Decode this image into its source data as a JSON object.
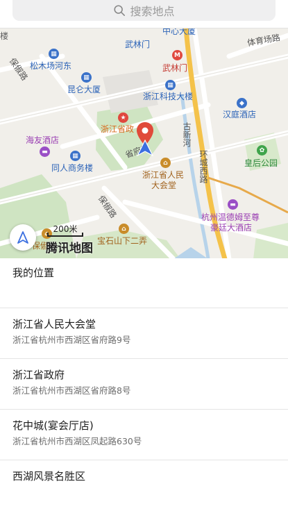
{
  "search": {
    "placeholder": "搜索地点"
  },
  "map": {
    "labels": {
      "zhongxin_dasha": "中心大厦",
      "wulinmen_top": "武林门",
      "tiyuchang_lu": "体育场路",
      "songmuchang_hedong": "松木场河东",
      "baochu_lu_left": "保俶路",
      "wulinmen_metro": "武林门",
      "kunlun_dasha": "昆仑大厦",
      "zhejiang_keji": "浙江科技大楼",
      "hanting": "汉庭酒店",
      "zhejiang_shengzheng_map": "浙江省政",
      "haiyou": "海友酒店",
      "shengfu_lu": "省府路",
      "guxinhe": "古新河",
      "huancheng_xilu": "环城西路",
      "huanghou_park": "皇后公园",
      "tongren": "同人商务楼",
      "renmin_dahuitang_line1": "浙江省人民",
      "renmin_dahuitang_line2": "大会堂",
      "baochu_lu_center": "保俶路",
      "wyndham_line1": "杭州温德姆至尊",
      "wyndham_line2": "豪廷大酒店",
      "baoshishan": "宝石山下二弄",
      "baochu_bottom": "保俶",
      "lou": "楼"
    },
    "scale_label": "200米",
    "logo_label": "腾讯地图",
    "colors": {
      "pin": "#e04a3a",
      "arrow": "#3b6fe0",
      "road_orange": "#e7a94a"
    }
  },
  "locate_icon": "navigation-arrow-icon",
  "list": {
    "my_location": "我的位置",
    "items": [
      {
        "name": "浙江省人民大会堂",
        "address": "浙江省杭州市西湖区省府路9号"
      },
      {
        "name": "浙江省政府",
        "address": "浙江省杭州市西湖区省府路8号"
      },
      {
        "name": "花中城(宴会厅店)",
        "address": "浙江省杭州市西湖区凤起路630号"
      },
      {
        "name": "西湖风景名胜区",
        "address": ""
      }
    ]
  }
}
